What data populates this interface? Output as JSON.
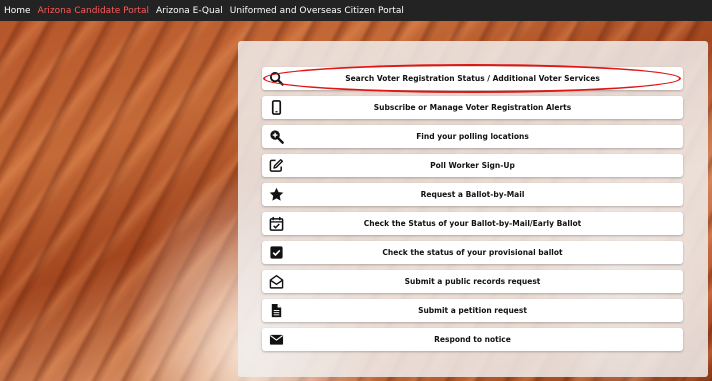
{
  "nav": {
    "links": [
      {
        "label": "Home",
        "active": false
      },
      {
        "label": "Arizona Candidate Portal",
        "active": true
      },
      {
        "label": "Arizona E-Qual",
        "active": false
      },
      {
        "label": "Uniformed and Overseas Citizen Portal",
        "active": false
      }
    ]
  },
  "colors": {
    "nav_bg": "#232323",
    "nav_active": "#ff5a5a",
    "annotation_ring": "#e01515"
  },
  "menu": {
    "items": [
      {
        "label": "Search Voter Registration Status / Additional Voter Services",
        "icon": "search-icon"
      },
      {
        "label": "Subscribe or Manage Voter Registration Alerts",
        "icon": "mobile-phone-icon"
      },
      {
        "label": "Find your polling locations",
        "icon": "zoom-in-icon"
      },
      {
        "label": "Poll Worker Sign-Up",
        "icon": "edit-icon"
      },
      {
        "label": "Request a Ballot-by-Mail",
        "icon": "star-icon"
      },
      {
        "label": "Check the Status of your Ballot-by-Mail/Early Ballot",
        "icon": "calendar-check-icon"
      },
      {
        "label": "Check the status of your provisional ballot",
        "icon": "checkbox-icon"
      },
      {
        "label": "Submit a public records request",
        "icon": "open-envelope-icon"
      },
      {
        "label": "Submit a petition request",
        "icon": "document-icon"
      },
      {
        "label": "Respond to notice",
        "icon": "envelope-icon"
      }
    ]
  }
}
